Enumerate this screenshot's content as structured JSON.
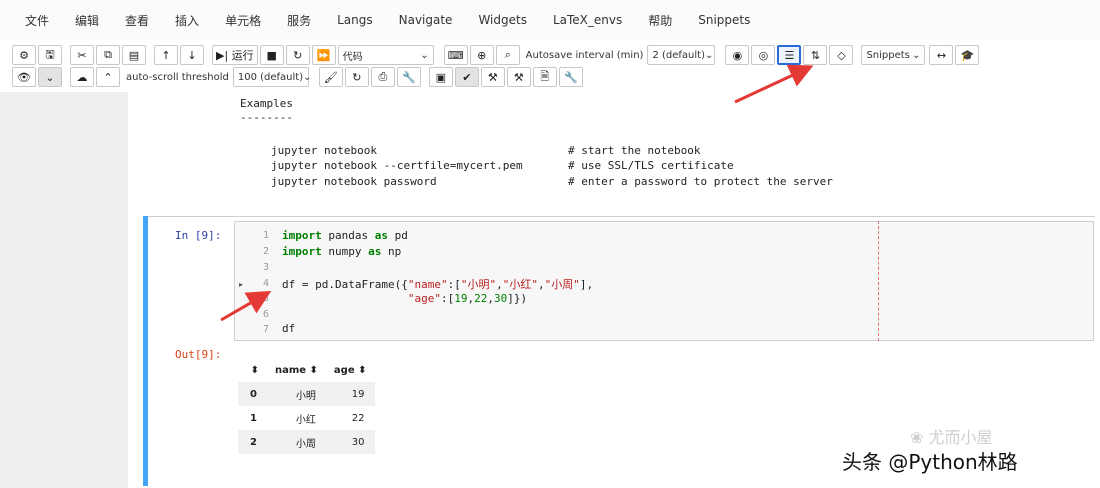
{
  "menu": [
    "文件",
    "编辑",
    "查看",
    "插入",
    "单元格",
    "服务",
    "Langs",
    "Navigate",
    "Widgets",
    "LaTeX_envs",
    "帮助",
    "Snippets"
  ],
  "toolbar": {
    "run_label": "运行",
    "cell_type": "代码",
    "autosave_label": "Autosave interval (min)",
    "autosave_value": "2 (default)",
    "snippets_value": "Snippets",
    "autoscroll_label": "auto-scroll threshold",
    "autoscroll_value": "100 (default)"
  },
  "help_text": {
    "heading": "Examples",
    "underline": "--------",
    "lines": [
      {
        "cmd": "jupyter notebook",
        "comment": "# start the notebook"
      },
      {
        "cmd": "jupyter notebook --certfile=mycert.pem",
        "comment": "# use SSL/TLS certificate"
      },
      {
        "cmd": "jupyter notebook password",
        "comment": "# enter a password to protect the server"
      }
    ]
  },
  "cell": {
    "in_prompt": "In [9]:",
    "out_prompt": "Out[9]:",
    "line_numbers": [
      "1",
      "2",
      "3",
      "4",
      "5",
      "6",
      "7"
    ]
  },
  "dataframe": {
    "columns": [
      "name",
      "age"
    ],
    "rows": [
      {
        "index": "0",
        "name": "小明",
        "age": "19"
      },
      {
        "index": "1",
        "name": "小红",
        "age": "22"
      },
      {
        "index": "2",
        "name": "小周",
        "age": "30"
      }
    ]
  },
  "watermark": "尤而小屋",
  "credit": "头条 @Python林路",
  "colors": {
    "cell_accent": "#42a5f5",
    "annotation_arrow": "#e53935",
    "highlight_button": "#2a6bd6"
  }
}
